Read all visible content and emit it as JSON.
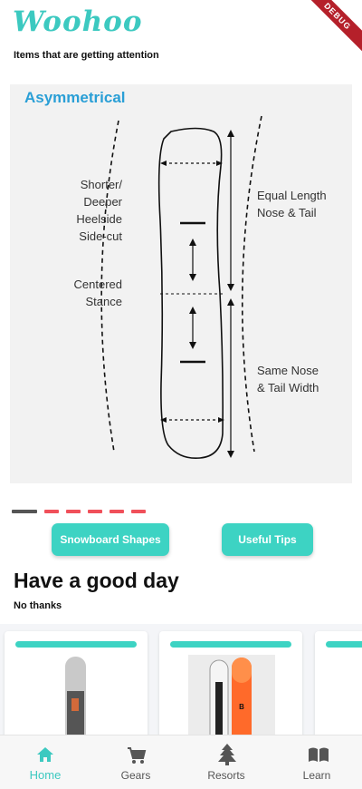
{
  "app": {
    "logo": "Woohoo",
    "subtitle": "Items that are getting attention",
    "debug_badge": "DEBUG"
  },
  "carousel": {
    "slide_title": "Asymmetrical",
    "annotations": {
      "left_top": [
        "Shorter/",
        "Deeper",
        "Heelside",
        "Side-cut"
      ],
      "left_mid": [
        "Centered",
        "Stance"
      ],
      "right_top": [
        "Equal Length",
        "Nose & Tail"
      ],
      "right_bottom": [
        "Same Nose",
        "& Tail Width"
      ]
    },
    "page_count": 6,
    "active_page": 1
  },
  "buttons": {
    "shapes": "Snowboard Shapes",
    "tips": "Useful Tips"
  },
  "section": {
    "title": "Have a good day",
    "dismiss": "No thanks"
  },
  "nav": [
    {
      "label": "Home",
      "icon": "home-icon",
      "active": true
    },
    {
      "label": "Gears",
      "icon": "cart-icon",
      "active": false
    },
    {
      "label": "Resorts",
      "icon": "tree-icon",
      "active": false
    },
    {
      "label": "Learn",
      "icon": "book-icon",
      "active": false
    }
  ],
  "colors": {
    "accent": "#3dd3c3",
    "pager_inactive": "#f0505a",
    "pager_active": "#555555"
  }
}
